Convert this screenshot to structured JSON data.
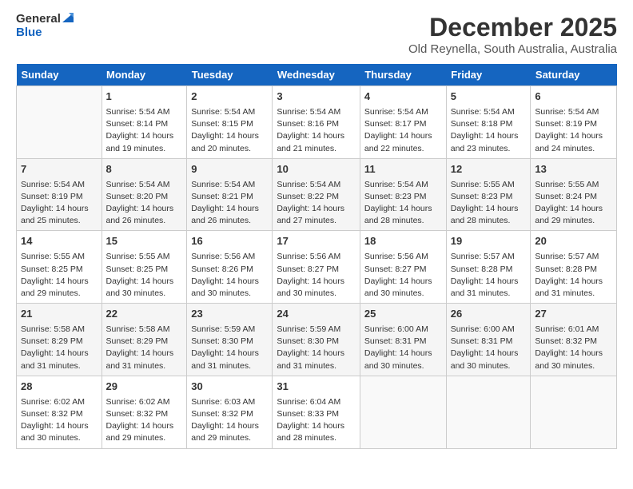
{
  "header": {
    "logo_general": "General",
    "logo_blue": "Blue",
    "title": "December 2025",
    "subtitle": "Old Reynella, South Australia, Australia"
  },
  "calendar": {
    "days_of_week": [
      "Sunday",
      "Monday",
      "Tuesday",
      "Wednesday",
      "Thursday",
      "Friday",
      "Saturday"
    ],
    "weeks": [
      [
        {
          "day": "",
          "info": ""
        },
        {
          "day": "1",
          "info": "Sunrise: 5:54 AM\nSunset: 8:14 PM\nDaylight: 14 hours\nand 19 minutes."
        },
        {
          "day": "2",
          "info": "Sunrise: 5:54 AM\nSunset: 8:15 PM\nDaylight: 14 hours\nand 20 minutes."
        },
        {
          "day": "3",
          "info": "Sunrise: 5:54 AM\nSunset: 8:16 PM\nDaylight: 14 hours\nand 21 minutes."
        },
        {
          "day": "4",
          "info": "Sunrise: 5:54 AM\nSunset: 8:17 PM\nDaylight: 14 hours\nand 22 minutes."
        },
        {
          "day": "5",
          "info": "Sunrise: 5:54 AM\nSunset: 8:18 PM\nDaylight: 14 hours\nand 23 minutes."
        },
        {
          "day": "6",
          "info": "Sunrise: 5:54 AM\nSunset: 8:19 PM\nDaylight: 14 hours\nand 24 minutes."
        }
      ],
      [
        {
          "day": "7",
          "info": "Sunrise: 5:54 AM\nSunset: 8:19 PM\nDaylight: 14 hours\nand 25 minutes."
        },
        {
          "day": "8",
          "info": "Sunrise: 5:54 AM\nSunset: 8:20 PM\nDaylight: 14 hours\nand 26 minutes."
        },
        {
          "day": "9",
          "info": "Sunrise: 5:54 AM\nSunset: 8:21 PM\nDaylight: 14 hours\nand 26 minutes."
        },
        {
          "day": "10",
          "info": "Sunrise: 5:54 AM\nSunset: 8:22 PM\nDaylight: 14 hours\nand 27 minutes."
        },
        {
          "day": "11",
          "info": "Sunrise: 5:54 AM\nSunset: 8:23 PM\nDaylight: 14 hours\nand 28 minutes."
        },
        {
          "day": "12",
          "info": "Sunrise: 5:55 AM\nSunset: 8:23 PM\nDaylight: 14 hours\nand 28 minutes."
        },
        {
          "day": "13",
          "info": "Sunrise: 5:55 AM\nSunset: 8:24 PM\nDaylight: 14 hours\nand 29 minutes."
        }
      ],
      [
        {
          "day": "14",
          "info": "Sunrise: 5:55 AM\nSunset: 8:25 PM\nDaylight: 14 hours\nand 29 minutes."
        },
        {
          "day": "15",
          "info": "Sunrise: 5:55 AM\nSunset: 8:25 PM\nDaylight: 14 hours\nand 30 minutes."
        },
        {
          "day": "16",
          "info": "Sunrise: 5:56 AM\nSunset: 8:26 PM\nDaylight: 14 hours\nand 30 minutes."
        },
        {
          "day": "17",
          "info": "Sunrise: 5:56 AM\nSunset: 8:27 PM\nDaylight: 14 hours\nand 30 minutes."
        },
        {
          "day": "18",
          "info": "Sunrise: 5:56 AM\nSunset: 8:27 PM\nDaylight: 14 hours\nand 30 minutes."
        },
        {
          "day": "19",
          "info": "Sunrise: 5:57 AM\nSunset: 8:28 PM\nDaylight: 14 hours\nand 31 minutes."
        },
        {
          "day": "20",
          "info": "Sunrise: 5:57 AM\nSunset: 8:28 PM\nDaylight: 14 hours\nand 31 minutes."
        }
      ],
      [
        {
          "day": "21",
          "info": "Sunrise: 5:58 AM\nSunset: 8:29 PM\nDaylight: 14 hours\nand 31 minutes."
        },
        {
          "day": "22",
          "info": "Sunrise: 5:58 AM\nSunset: 8:29 PM\nDaylight: 14 hours\nand 31 minutes."
        },
        {
          "day": "23",
          "info": "Sunrise: 5:59 AM\nSunset: 8:30 PM\nDaylight: 14 hours\nand 31 minutes."
        },
        {
          "day": "24",
          "info": "Sunrise: 5:59 AM\nSunset: 8:30 PM\nDaylight: 14 hours\nand 31 minutes."
        },
        {
          "day": "25",
          "info": "Sunrise: 6:00 AM\nSunset: 8:31 PM\nDaylight: 14 hours\nand 30 minutes."
        },
        {
          "day": "26",
          "info": "Sunrise: 6:00 AM\nSunset: 8:31 PM\nDaylight: 14 hours\nand 30 minutes."
        },
        {
          "day": "27",
          "info": "Sunrise: 6:01 AM\nSunset: 8:32 PM\nDaylight: 14 hours\nand 30 minutes."
        }
      ],
      [
        {
          "day": "28",
          "info": "Sunrise: 6:02 AM\nSunset: 8:32 PM\nDaylight: 14 hours\nand 30 minutes."
        },
        {
          "day": "29",
          "info": "Sunrise: 6:02 AM\nSunset: 8:32 PM\nDaylight: 14 hours\nand 29 minutes."
        },
        {
          "day": "30",
          "info": "Sunrise: 6:03 AM\nSunset: 8:32 PM\nDaylight: 14 hours\nand 29 minutes."
        },
        {
          "day": "31",
          "info": "Sunrise: 6:04 AM\nSunset: 8:33 PM\nDaylight: 14 hours\nand 28 minutes."
        },
        {
          "day": "",
          "info": ""
        },
        {
          "day": "",
          "info": ""
        },
        {
          "day": "",
          "info": ""
        }
      ]
    ]
  }
}
